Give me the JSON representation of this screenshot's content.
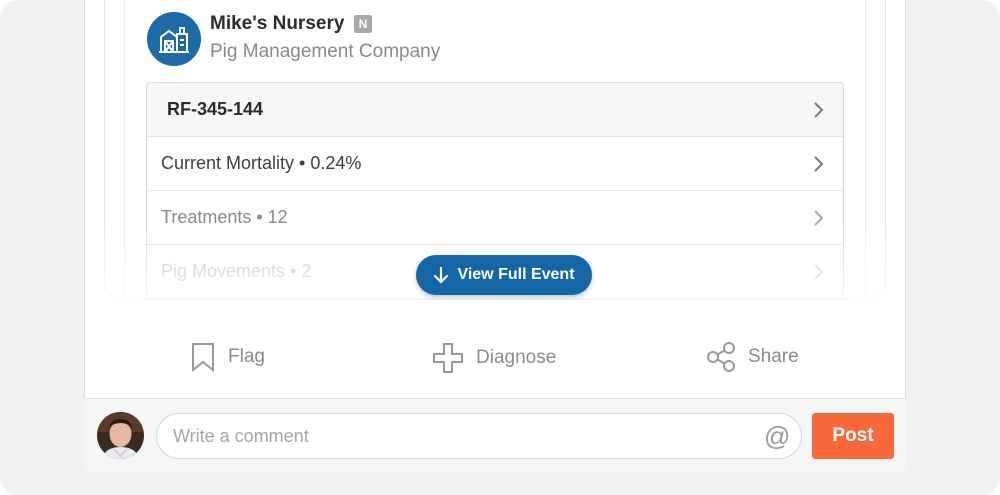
{
  "post": {
    "company_name": "Mike's Nursery",
    "company_badge": "N",
    "company_type": "Pig Management Company",
    "logo_icon": "barn-icon",
    "accent_color": "#1c6aa8"
  },
  "event_rows": [
    {
      "label": "RF-345-144"
    },
    {
      "label": "Current Mortality • 0.24%"
    },
    {
      "label": "Treatments • 12"
    },
    {
      "label": "Pig Movements • 2"
    }
  ],
  "view_full_event": {
    "label": "View Full Event",
    "icon": "arrow-down-icon"
  },
  "actions": {
    "flag": {
      "label": "Flag",
      "icon": "bookmark-icon"
    },
    "diagnose": {
      "label": "Diagnose",
      "icon": "plus-icon"
    },
    "share": {
      "label": "Share",
      "icon": "share-icon"
    }
  },
  "comment": {
    "placeholder": "Write a comment",
    "value": "",
    "mention_icon": "at-icon",
    "post_label": "Post",
    "post_color": "#f7683a"
  }
}
